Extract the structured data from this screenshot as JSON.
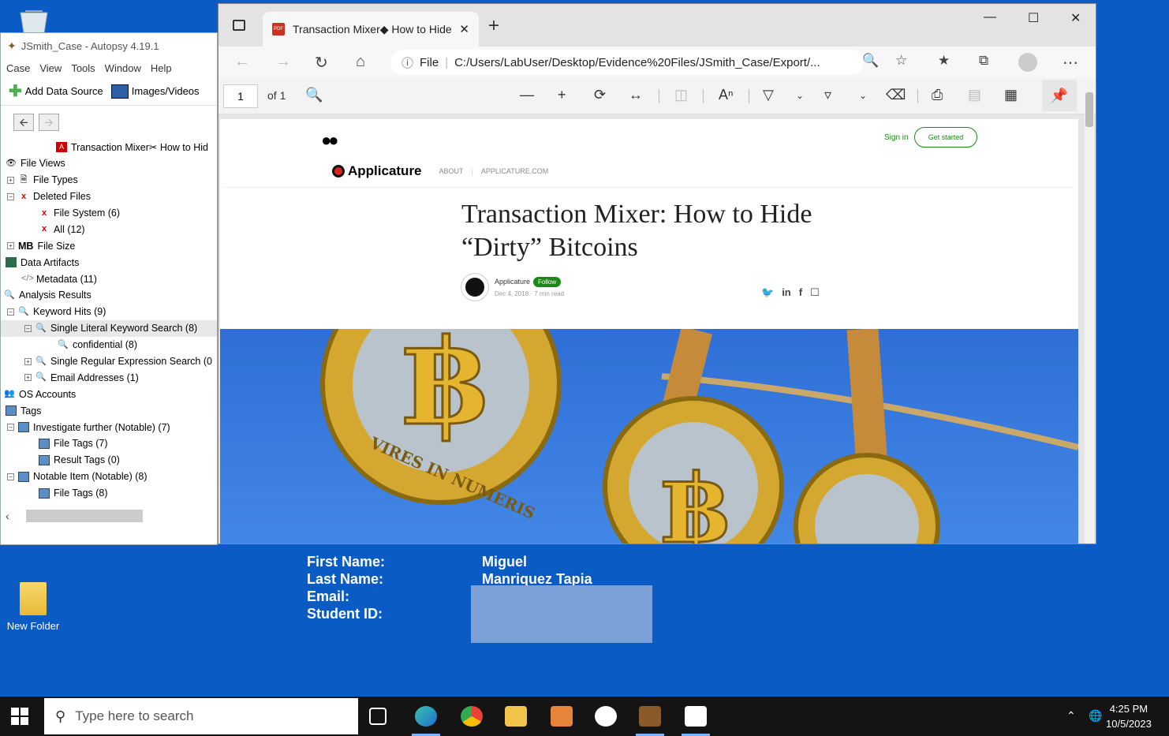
{
  "desktop": {
    "folder_label": "New Folder",
    "info": {
      "first_name_label": "First Name:",
      "first_name_value": "Miguel",
      "last_name_label": "Last Name:",
      "last_name_value": "Manriquez Tapia",
      "email_label": "Email:",
      "student_id_label": "Student ID:"
    }
  },
  "autopsy": {
    "title": "JSmith_Case - Autopsy 4.19.1",
    "menu": [
      "Case",
      "View",
      "Tools",
      "Window",
      "Help"
    ],
    "toolbar": {
      "add_data_source": "Add Data Source",
      "images_videos": "Images/Videos"
    },
    "tree": [
      {
        "label": "Transaction Mixer✂ How to Hid",
        "icon": "pdf-file-icon"
      },
      {
        "label": "File Views",
        "icon": "eye-icon"
      },
      {
        "label": "File Types",
        "icon": "file-types-icon"
      },
      {
        "label": "Deleted Files",
        "icon": "deleted-icon"
      },
      {
        "label": "File System (6)",
        "icon": "deleted-icon"
      },
      {
        "label": "All (12)",
        "icon": "deleted-icon"
      },
      {
        "label": "File Size",
        "icon": "mb-icon",
        "prefix": "MB"
      },
      {
        "label": "Data Artifacts",
        "icon": "database-icon"
      },
      {
        "label": "Metadata (11)",
        "icon": "code-icon"
      },
      {
        "label": "Analysis Results",
        "icon": "magnifier-icon"
      },
      {
        "label": "Keyword Hits (9)",
        "icon": "magnifier-icon"
      },
      {
        "label": "Single Literal Keyword Search (8)",
        "icon": "magnifier-icon"
      },
      {
        "label": "confidential (8)",
        "icon": "magnifier-icon"
      },
      {
        "label": "Single Regular Expression Search (0",
        "icon": "magnifier-icon"
      },
      {
        "label": "Email Addresses (1)",
        "icon": "magnifier-icon"
      },
      {
        "label": "OS Accounts",
        "icon": "users-icon"
      },
      {
        "label": "Tags",
        "icon": "tag-icon"
      },
      {
        "label": "Investigate further  (Notable) (7)",
        "icon": "tag-icon"
      },
      {
        "label": "File Tags (7)",
        "icon": "tag-icon"
      },
      {
        "label": "Result Tags (0)",
        "icon": "tag-icon"
      },
      {
        "label": "Notable Item (Notable) (8)",
        "icon": "tag-icon"
      },
      {
        "label": "File Tags (8)",
        "icon": "tag-icon"
      }
    ]
  },
  "browser": {
    "tab_title": "Transaction Mixer◆ How to Hide",
    "url_prefix": "File",
    "url": "C:/Users/LabUser/Desktop/Evidence%20Files/JSmith_Case/Export/...",
    "pdf": {
      "page_number": "1",
      "page_of": "of 1"
    }
  },
  "article": {
    "sign_in": "Sign in",
    "get_started": "Get started",
    "publication": "Applicature",
    "nav_about": "ABOUT",
    "nav_site": "APPLICATURE.COM",
    "headline": "Transaction Mixer: How to Hide “Dirty” Bitcoins",
    "author": "Applicature",
    "follow": "Follow",
    "meta": "Dec 4, 2018 · 7 min read",
    "coin_text": "VIRES IN NUMERIS"
  },
  "taskbar": {
    "search_placeholder": "Type here to search",
    "time": "4:25 PM",
    "date": "10/5/2023"
  }
}
